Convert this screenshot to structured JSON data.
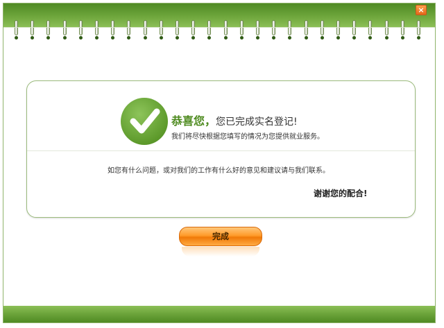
{
  "window": {
    "close_symbol": "×"
  },
  "message": {
    "title_strong": "恭喜您，",
    "title_rest": "您已完成实名登记!",
    "subtitle": "我们将尽快根据您填写的情况为您提供就业服务。",
    "contact": "如您有什么问题，或对我们的工作有什么好的意见和建议请与我们联系。",
    "thanks": "谢谢您的配合!"
  },
  "actions": {
    "finish_label": "完成"
  },
  "icons": {
    "success": "check-circle-icon",
    "close": "close-icon"
  },
  "colors": {
    "accent_green": "#5d9a2b",
    "button_orange": "#ff9b2a",
    "close_orange": "#e4671a"
  }
}
